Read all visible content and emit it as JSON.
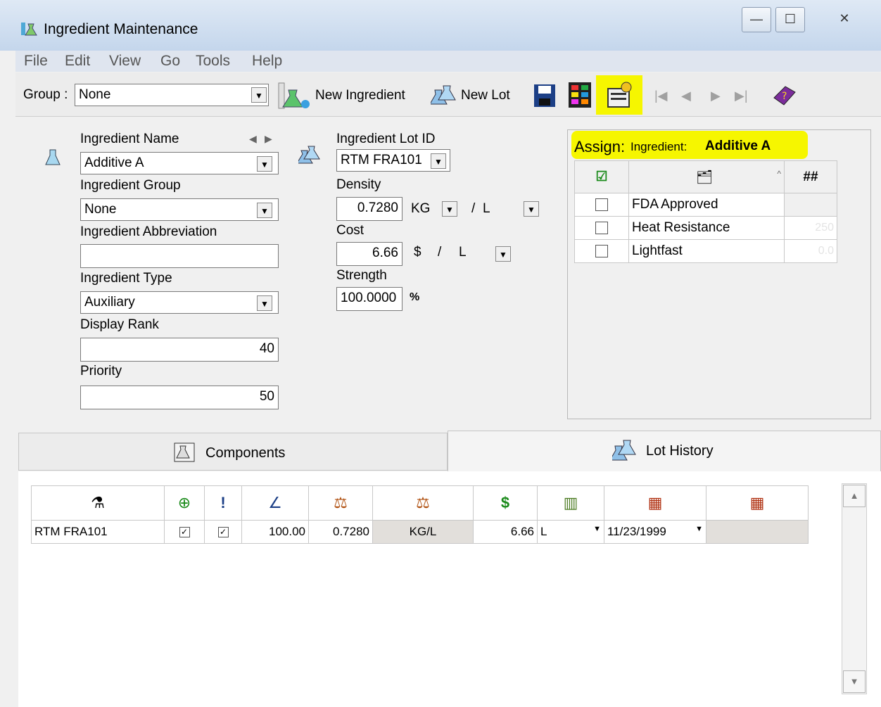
{
  "window": {
    "title": "Ingredient Maintenance",
    "controls": {
      "minimize": "—",
      "maximize": "☐",
      "close": "✕"
    }
  },
  "menu": [
    "File",
    "Edit",
    "View",
    "Go",
    "Tools",
    "Help"
  ],
  "toolbar": {
    "group_label": "Group :",
    "group_value": "None",
    "new_ingredient": "New Ingredient",
    "new_lot": "New Lot"
  },
  "ingredient": {
    "name_label": "Ingredient Name",
    "name_value": "Additive A",
    "group_label": "Ingredient Group",
    "group_value": "None",
    "abbrev_label": "Ingredient Abbreviation",
    "abbrev_value": "",
    "type_label": "Ingredient Type",
    "type_value": "Auxiliary",
    "rank_label": "Display Rank",
    "rank_value": "40",
    "priority_label": "Priority",
    "priority_value": "50"
  },
  "lot": {
    "id_label": "Ingredient Lot ID",
    "id_value": "RTM FRA101",
    "density_label": "Density",
    "density_value": "0.7280",
    "density_unit": "KG",
    "density_slash": "/",
    "density_per": "L",
    "cost_label": "Cost",
    "cost_value": "6.66",
    "cost_unit": "$",
    "cost_slash": "/",
    "cost_per": "L",
    "strength_label": "Strength",
    "strength_value": "100.0000",
    "strength_unit": "%"
  },
  "assign": {
    "prefix": "Assign:",
    "caption": "Ingredient:",
    "ingredient": "Additive A",
    "header_hash": "##",
    "rows": [
      {
        "name": "FDA Approved",
        "value": ""
      },
      {
        "name": "Heat Resistance",
        "value": "250"
      },
      {
        "name": "Lightfast",
        "value": "0.0"
      }
    ]
  },
  "tabs": {
    "components": "Components",
    "lot_history": "Lot History"
  },
  "lot_history": {
    "rows": [
      {
        "id": "RTM FRA101",
        "strength": "100.00",
        "density": "0.7280",
        "unit": "KG/L",
        "cost": "6.66",
        "cost_unit": "L",
        "date": "11/23/1999",
        "extra": ""
      }
    ]
  },
  "colors": {
    "highlight": "#f6f600",
    "title_grad_top": "#dfe9f5",
    "title_grad_bottom": "#c4d6ec"
  },
  "icons": [
    "app-icon",
    "flask-icon",
    "save-icon",
    "color-palette-icon",
    "assign-properties-icon",
    "first-record-icon",
    "prev-record-icon",
    "next-record-icon",
    "last-record-icon",
    "help-book-icon"
  ]
}
